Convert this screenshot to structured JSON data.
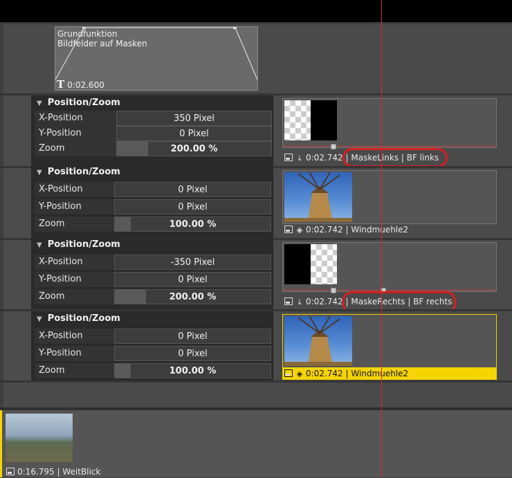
{
  "title_clip": {
    "line1": "Grundfunktion",
    "line2": "Bildfelder auf Masken",
    "duration": "0:02.600",
    "icon": "text-T-icon"
  },
  "panels": [
    {
      "header": "Position/Zoom",
      "rows": [
        {
          "label": "X-Position",
          "value": "350 Pixel"
        },
        {
          "label": "Y-Position",
          "value": "0 Pixel"
        },
        {
          "label": "Zoom",
          "value": "200.00 %",
          "fill": 0.2
        }
      ]
    },
    {
      "header": "Position/Zoom",
      "rows": [
        {
          "label": "X-Position",
          "value": "0 Pixel"
        },
        {
          "label": "Y-Position",
          "value": "0 Pixel"
        },
        {
          "label": "Zoom",
          "value": "100.00 %",
          "fill": 0.1
        }
      ]
    },
    {
      "header": "Position/Zoom",
      "rows": [
        {
          "label": "X-Position",
          "value": "-350 Pixel"
        },
        {
          "label": "Y-Position",
          "value": "0 Pixel"
        },
        {
          "label": "Zoom",
          "value": "200.00 %",
          "fill": 0.2
        }
      ]
    },
    {
      "header": "Position/Zoom",
      "rows": [
        {
          "label": "X-Position",
          "value": "0 Pixel"
        },
        {
          "label": "Y-Position",
          "value": "0 Pixel"
        },
        {
          "label": "Zoom",
          "value": "100.00 %",
          "fill": 0.1
        }
      ]
    }
  ],
  "clips": [
    {
      "duration": "0:02.742",
      "name": "| MaskeLinks | BF links",
      "icon": "image-icon",
      "type_icon": "download-icon"
    },
    {
      "duration": "0:02.742",
      "name": "| Windmuehle2",
      "icon": "image-icon",
      "type_icon": "layers-icon"
    },
    {
      "duration": "0:02.742",
      "name": "| MaskeRechts | BF rechts",
      "icon": "image-icon",
      "type_icon": "download-icon"
    },
    {
      "duration": "0:02.742",
      "name": "| Windmuehle2",
      "icon": "image-icon",
      "type_icon": "layers-icon",
      "selected": true
    }
  ],
  "bottom_clip": {
    "duration": "0:16.795",
    "name": "| WeitBlick",
    "icon": "image-icon"
  },
  "colors": {
    "selected": "#f5d400",
    "playhead": "#d82a2a",
    "highlight_oval": "#d71f1f"
  }
}
